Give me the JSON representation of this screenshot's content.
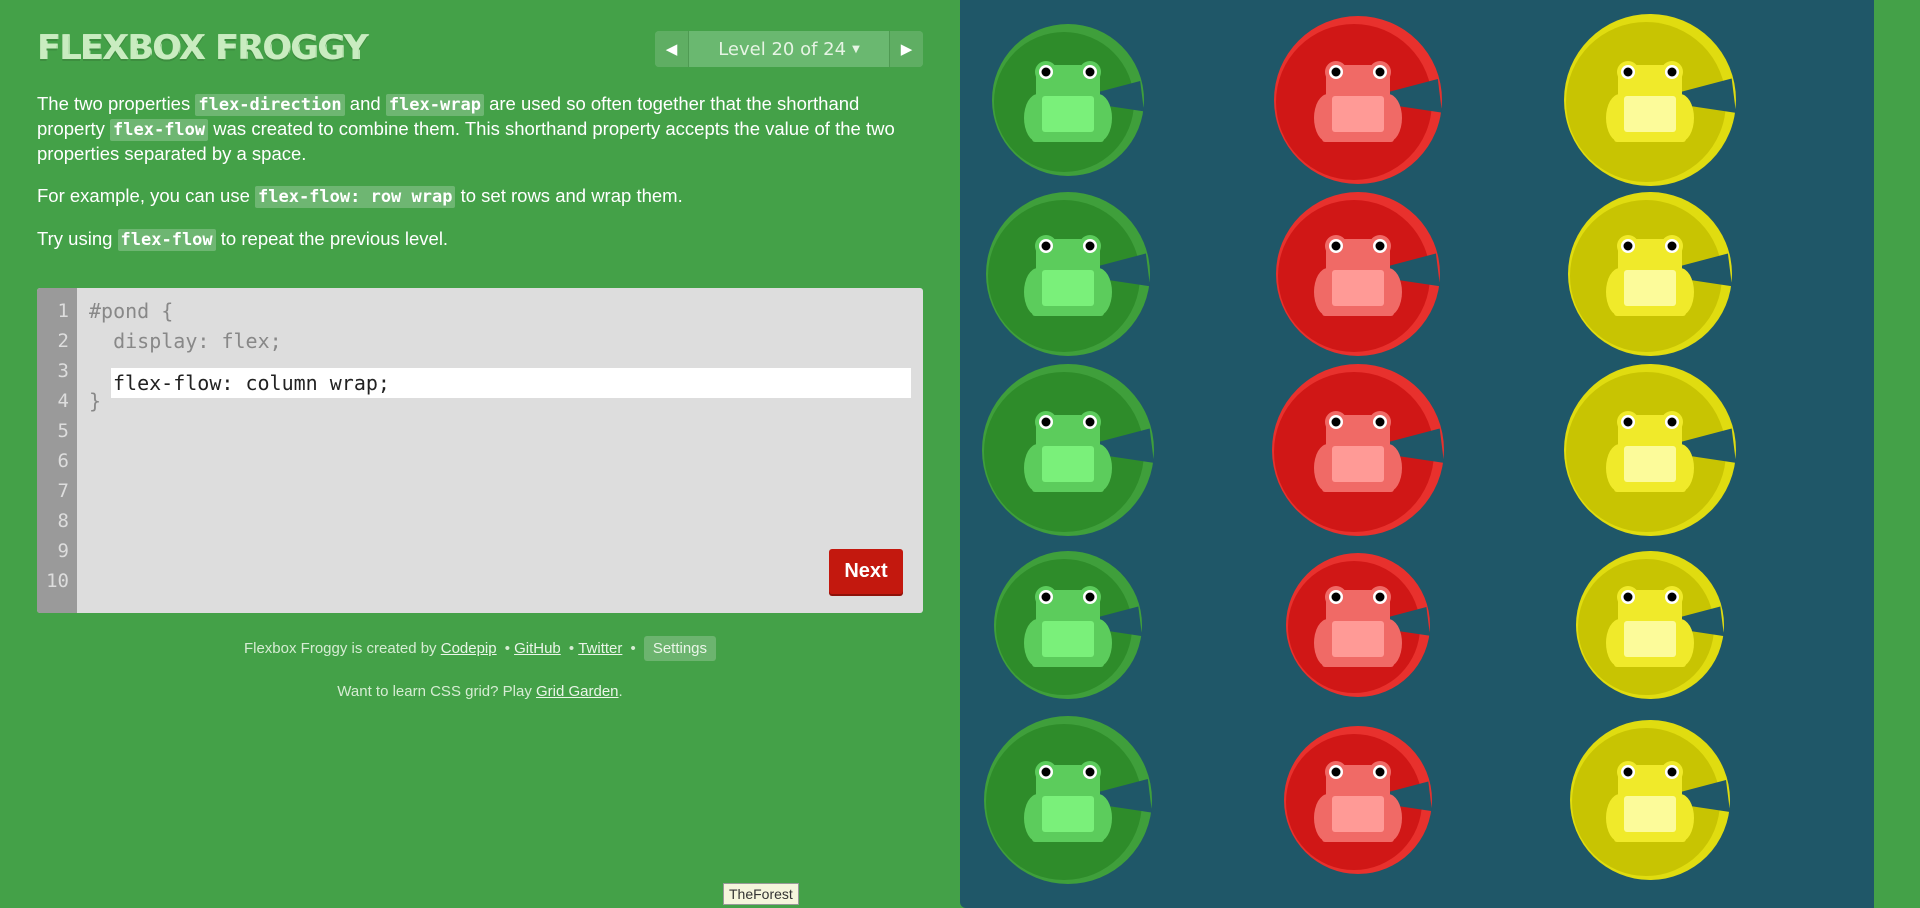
{
  "header": {
    "title": "FLEXBOX FROGGY",
    "level_label": "Level 20 of 24",
    "caret": "▼",
    "prev_icon": "◀",
    "next_icon": "▶"
  },
  "instructions": {
    "p1": {
      "t1": "The two properties ",
      "c1": "flex-direction",
      "t2": " and ",
      "c2": "flex-wrap",
      "t3": " are used so often together that the shorthand property ",
      "c3": "flex-flow",
      "t4": " was created to combine them. This shorthand property accepts the value of the two properties separated by a space."
    },
    "p2": {
      "t1": "For example, you can use ",
      "c1": "flex-flow: row wrap",
      "t2": " to set rows and wrap them."
    },
    "p3": {
      "t1": "Try using ",
      "c1": "flex-flow",
      "t2": " to repeat the previous level."
    }
  },
  "editor": {
    "line_numbers": [
      "1",
      "2",
      "3",
      "4",
      "5",
      "6",
      "7",
      "8",
      "9",
      "10"
    ],
    "line1": "#pond {",
    "line2": "  display: flex;",
    "input_value": "flex-flow: column wrap;",
    "line4": "}",
    "next_label": "Next"
  },
  "credits": {
    "prefix": "Flexbox Froggy is created by ",
    "codepip": "Codepip",
    "bullet": "•",
    "github": "GitHub",
    "twitter": "Twitter",
    "settings": "Settings"
  },
  "promo": {
    "prefix": "Want to learn CSS grid? Play ",
    "link": "Grid Garden",
    "suffix": "."
  },
  "tooltip": "TheForest",
  "board": {
    "colors": {
      "pond": "#1f5768",
      "green": "#2e8c2a",
      "green_light": "#3f9f3b",
      "red": "#d01716",
      "red_light": "#e8312d",
      "yellow": "#c8c402",
      "yellow_light": "#e0dc10"
    },
    "columns": [
      {
        "color": "green",
        "frogs": 5
      },
      {
        "color": "red",
        "frogs": 5
      },
      {
        "color": "yellow",
        "frogs": 5
      }
    ]
  }
}
